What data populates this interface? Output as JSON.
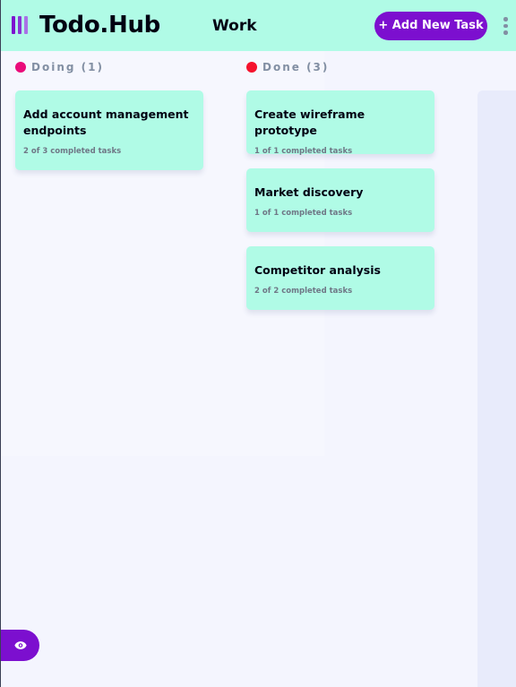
{
  "header": {
    "brand": "Todo.Hub",
    "board_title": "Work",
    "add_task_label": "+ Add New Task",
    "menu_icon": "vertical-ellipsis-icon",
    "logo_icon": "board-bars-icon"
  },
  "colors": {
    "header_bg": "#b0fbe6",
    "card_bg": "#b0fbe6",
    "accent": "#7c0fcf",
    "page_bg": "#f4f5fe",
    "logo_bars": [
      "#7c0fcf",
      "#8a35d6",
      "#a971e6"
    ]
  },
  "columns": [
    {
      "name": "Doing (1)",
      "dot_color": "#ea0c7a",
      "tasks": [
        {
          "title": "Add account management endpoints",
          "subtasks": "2 of 3 completed tasks"
        }
      ]
    },
    {
      "name": "Done (3)",
      "dot_color": "#f5122d",
      "tasks": [
        {
          "title": "Create wireframe prototype",
          "subtasks": "1 of 1 completed tasks"
        },
        {
          "title": "Market discovery",
          "subtasks": "1 of 1 completed tasks"
        },
        {
          "title": "Competitor analysis",
          "subtasks": "2 of 2 completed tasks"
        }
      ]
    }
  ],
  "sidebar_toggle": {
    "icon": "eye-icon"
  }
}
